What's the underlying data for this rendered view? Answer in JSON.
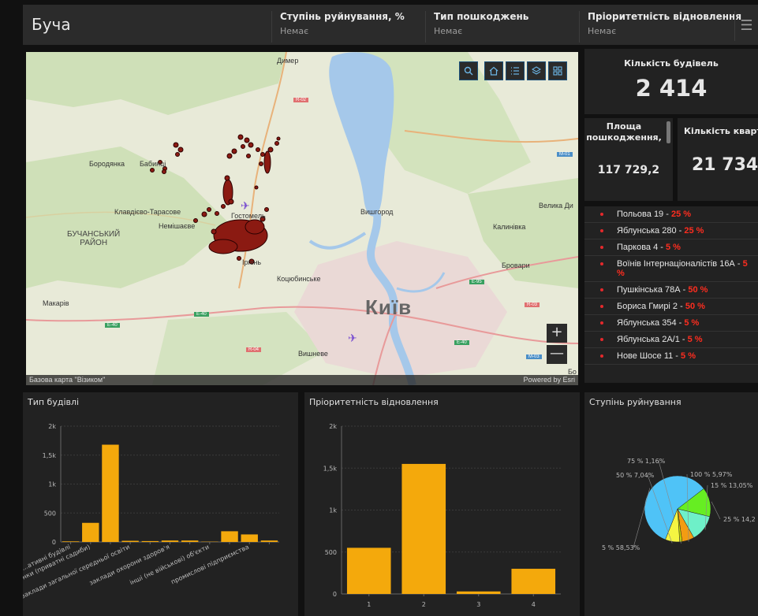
{
  "header": {
    "title": "Буча",
    "filters": [
      {
        "label": "Ступінь руйнування, %",
        "value": "Немає"
      },
      {
        "label": "Тип пошкоджень",
        "value": "Немає"
      },
      {
        "label": "Пріоритетність відновлення",
        "value": "Немає"
      }
    ],
    "menu_icon": "hamburger-icon"
  },
  "map": {
    "labels": {
      "dymer": "Димер",
      "borodianka": "Бородянка",
      "babyntsi": "Бабинці",
      "klavdievo": "Клавдієво-Тарасове",
      "nemishaieve": "Немішаєве",
      "hostomel": "Гостомель",
      "bucha_region": "БУЧАНСЬКИЙ\nРАЙОН",
      "irpin": "Ірпінь",
      "vyshhorod": "Вишгород",
      "velyka_dymerka": "Велика Ди",
      "kalynivka": "Калинівка",
      "brovary": "Бровари",
      "kotsiubynske": "Коцюбинське",
      "makariv": "Макарів",
      "kyiv": "Київ",
      "vyshneve": "Вишневе",
      "bo": "Бо"
    },
    "road_signs": [
      "R-02",
      "M-01",
      "E-95",
      "R-03",
      "E-40",
      "E-40",
      "R-04",
      "E-40",
      "M-03"
    ],
    "tools": [
      "search-icon",
      "home-icon",
      "list-icon",
      "layers-icon",
      "basemap-gallery-icon"
    ],
    "zoom_in": "+",
    "zoom_out": "—",
    "attribution_left": "Базова карта \"Візиком\"",
    "attribution_right": "Powered by Esri"
  },
  "kpis": {
    "buildings": {
      "title": "Кількість будівель",
      "value": "2 414"
    },
    "area": {
      "title": "Площа пошкодження,",
      "value": "117 729,2"
    },
    "apartments": {
      "title": "Кількість квартир",
      "value": "21 734"
    }
  },
  "damage_list": [
    {
      "name": "Польова 19 - ",
      "pct": "25 %"
    },
    {
      "name": "Яблунська 280 - ",
      "pct": "25 %"
    },
    {
      "name": "Паркова 4 - ",
      "pct": "5 %"
    },
    {
      "name": "Воїнів Інтернаціоналістів 16А - ",
      "pct": "5 %"
    },
    {
      "name": "Пушкінська 78А - ",
      "pct": "50 %"
    },
    {
      "name": "Бориса Гмирі 2 - ",
      "pct": "50 %"
    },
    {
      "name": "Яблунська 354 - ",
      "pct": "5 %"
    },
    {
      "name": "Яблунська 2А/1 - ",
      "pct": "5 %"
    },
    {
      "name": "Нове Шосе 11 - ",
      "pct": "5 %"
    }
  ],
  "chart_data": [
    {
      "type": "bar",
      "title": "Тип будівлі",
      "categories": [
        "...ативні будівлі",
        ", будинки (приватні садиби)",
        "",
        "заклади загальної середньої освіти",
        "",
        "заклади охорони здоров'я",
        "",
        "інші (не військові) об'єкти",
        "",
        "промислові підприємства",
        ""
      ],
      "values": [
        10,
        330,
        1680,
        20,
        15,
        25,
        25,
        5,
        185,
        130,
        25
      ],
      "yticks": [
        "0",
        "500",
        "1k",
        "1,5k",
        "2k"
      ],
      "ylim": [
        0,
        2000
      ],
      "color": "#f4a90c"
    },
    {
      "type": "bar",
      "title": "Пріоритетність відновлення",
      "categories": [
        "1",
        "2",
        "3",
        "4"
      ],
      "values": [
        550,
        1550,
        30,
        300
      ],
      "yticks": [
        "0",
        "500",
        "1k",
        "1,5k",
        "2k"
      ],
      "ylim": [
        0,
        2000
      ],
      "color": "#f4a90c"
    },
    {
      "type": "pie",
      "title": "Ступінь руйнування",
      "slices": [
        {
          "label": "5 % 58,53%",
          "value": 58.53,
          "color": "#4fc3f7"
        },
        {
          "label": "25 % 14,2",
          "value": 14.21,
          "color": "#66ee22"
        },
        {
          "label": "15 % 13,05%",
          "value": 13.05,
          "color": "#6ef0c8"
        },
        {
          "label": "100 % 5,97%",
          "value": 5.97,
          "color": "#f39c12"
        },
        {
          "label": "75 % 1,16%",
          "value": 1.16,
          "color": "#ccdd00"
        },
        {
          "label": "50 % 7,04%",
          "value": 7.04,
          "color": "#f5f542"
        }
      ]
    }
  ]
}
